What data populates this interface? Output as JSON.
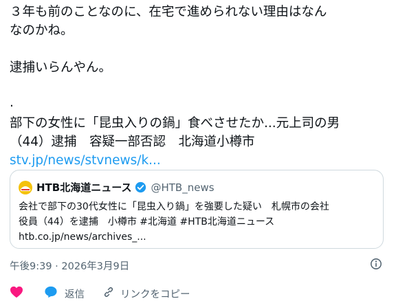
{
  "tweet": {
    "lines": [
      "３年も前のことなのに、在宅で進められない理由はなん",
      "なのかね。",
      "逮捕いらんやん。",
      ".",
      "部下の女性に「昆虫入りの鍋」食べさせたか...元上司の男",
      "（44）逮捕　容疑一部否認　北海道小樽市"
    ],
    "link": "stv.jp/news/stvnews/k..."
  },
  "quote": {
    "name": "HTB北海道ニュース",
    "handle": "@HTB_news",
    "body_lines": [
      "会社で部下の30代女性に「昆虫入り鍋」を強要した疑い　札幌市の会社",
      "役員（44）を逮捕　小樽市 #北海道 #HTB北海道ニュース"
    ],
    "link": "htb.co.jp/news/archives_..."
  },
  "meta": {
    "timestamp": "午後9:39 · 2026年3月9日"
  },
  "actions": {
    "reply_label": "返信",
    "copy_label": "リンクをコピー"
  },
  "colors": {
    "link": "#1d9bf0",
    "heart": "#f91880",
    "verified": "#1d9bf0",
    "secondary": "#536471",
    "border": "#cfd9de"
  },
  "icons": [
    "heart-icon",
    "reply-icon",
    "link-icon",
    "info-icon",
    "verified-icon",
    "avatar-icon"
  ]
}
